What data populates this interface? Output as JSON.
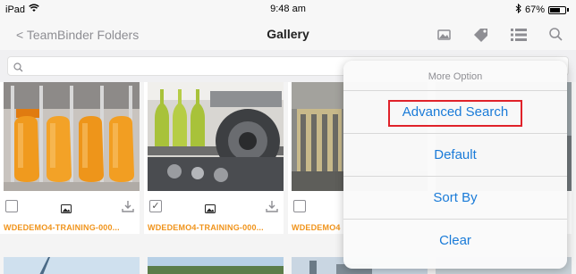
{
  "status": {
    "device": "iPad",
    "time": "9:48 am",
    "battery": "67%",
    "battery_level": 0.67
  },
  "nav": {
    "back_label": "< TeamBinder",
    "folders_label": "Folders",
    "title": "Gallery"
  },
  "search": {
    "placeholder": ""
  },
  "cards": [
    {
      "label": "WDEDEMO4-TRAINING-000...",
      "checked": false
    },
    {
      "label": "WDEDEMO4-TRAINING-000...",
      "checked": true
    },
    {
      "label": "WDEDEMO4",
      "checked": false
    }
  ],
  "dropdown": {
    "header": "More Option",
    "items": [
      "Advanced Search",
      "Default",
      "Sort By",
      "Clear"
    ],
    "highlighted_index": 0
  },
  "colors": {
    "accent": "#1a7bd8",
    "label_orange": "#f0931a",
    "highlight_red": "#e0222a"
  },
  "icons": [
    "wifi-icon",
    "bluetooth-icon",
    "image-icon",
    "tag-icon",
    "list-icon",
    "search-icon",
    "download-icon"
  ]
}
